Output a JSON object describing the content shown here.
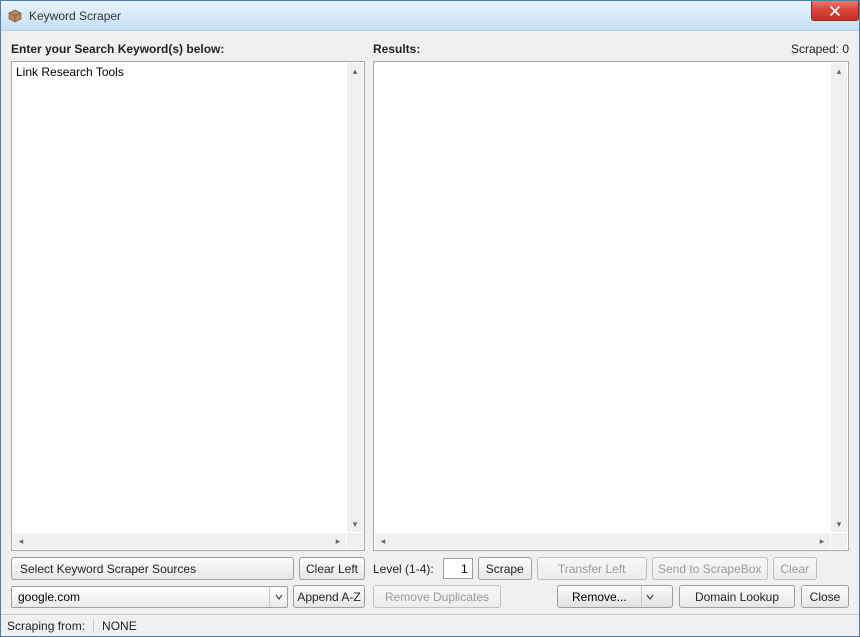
{
  "window": {
    "title": "Keyword Scraper"
  },
  "left": {
    "label": "Enter your Search Keyword(s) below:",
    "textarea_value": "Link Research Tools",
    "select_sources_btn": "Select Keyword Scraper Sources",
    "clear_left_btn": "Clear Left",
    "source_combo": "google.com",
    "append_btn": "Append A-Z"
  },
  "right": {
    "label": "Results:",
    "scraped_label": "Scraped: 0",
    "textarea_value": "",
    "level_label": "Level (1-4):",
    "level_value": "1",
    "scrape_btn": "Scrape",
    "transfer_left_btn": "Transfer Left",
    "send_scrapebox_btn": "Send to ScrapeBox",
    "clear_btn": "Clear",
    "remove_dup_btn": "Remove Duplicates",
    "remove_dd": "Remove...",
    "domain_lookup_btn": "Domain Lookup",
    "close_btn": "Close"
  },
  "status": {
    "label": "Scraping from:",
    "value": "NONE"
  }
}
